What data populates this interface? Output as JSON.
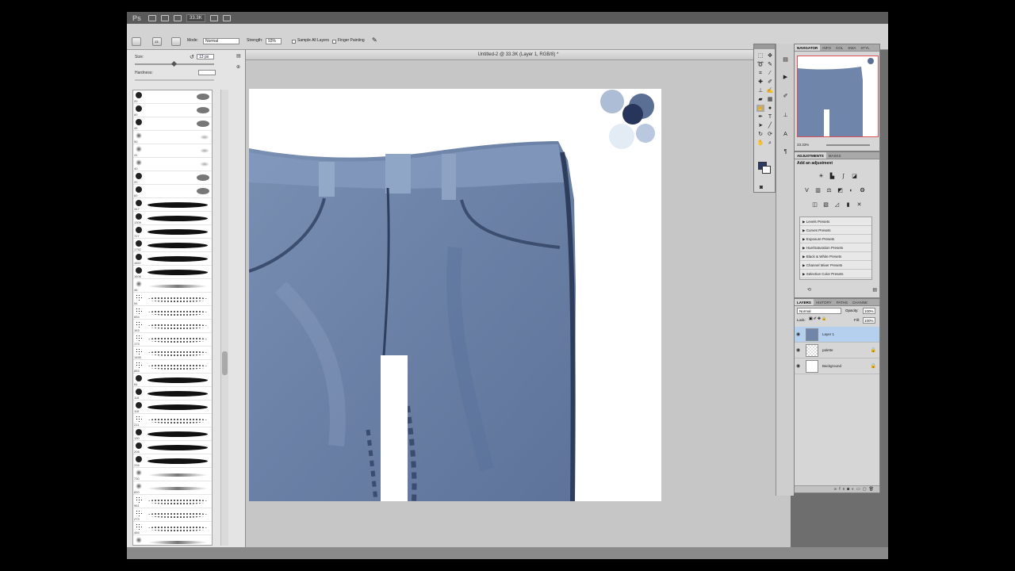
{
  "app": {
    "logo": "Ps",
    "zoom_display": "33.3K"
  },
  "options_bar": {
    "mode_label": "Mode:",
    "mode_value": "Normal",
    "strength_label": "Strength:",
    "strength_value": "93%",
    "sample_all_layers": "Sample All Layers",
    "finger_painting": "Finger Painting",
    "brush_size_display": "13"
  },
  "brush_panel": {
    "size_label": "Size:",
    "size_value": "13 px",
    "hardness_label": "Hardness:",
    "brushes": [
      {
        "size": "20",
        "kind": "round"
      },
      {
        "size": "60",
        "kind": "round"
      },
      {
        "size": "45",
        "kind": "round"
      },
      {
        "size": "50",
        "kind": "soft"
      },
      {
        "size": "41",
        "kind": "soft"
      },
      {
        "size": "40",
        "kind": "soft"
      },
      {
        "size": "20",
        "kind": "round"
      },
      {
        "size": "60",
        "kind": "round"
      },
      {
        "size": "347",
        "kind": "stroke"
      },
      {
        "size": "1309",
        "kind": "stroke"
      },
      {
        "size": "727",
        "kind": "stroke"
      },
      {
        "size": "1752",
        "kind": "stroke"
      },
      {
        "size": "1857",
        "kind": "stroke"
      },
      {
        "size": "1606",
        "kind": "stroke"
      },
      {
        "size": "46",
        "kind": "soft-stroke"
      },
      {
        "size": "54",
        "kind": "spatter"
      },
      {
        "size": "654",
        "kind": "spatter"
      },
      {
        "size": "163",
        "kind": "spatter"
      },
      {
        "size": "173",
        "kind": "spatter"
      },
      {
        "size": "1455",
        "kind": "spatter"
      },
      {
        "size": "883",
        "kind": "spatter"
      },
      {
        "size": "84",
        "kind": "stroke"
      },
      {
        "size": "118",
        "kind": "stroke"
      },
      {
        "size": "116",
        "kind": "stroke"
      },
      {
        "size": "211",
        "kind": "spatter"
      },
      {
        "size": "130",
        "kind": "stroke"
      },
      {
        "size": "208",
        "kind": "stroke"
      },
      {
        "size": "226",
        "kind": "stroke"
      },
      {
        "size": "730",
        "kind": "soft-stroke"
      },
      {
        "size": "820",
        "kind": "soft-stroke"
      },
      {
        "size": "961",
        "kind": "spatter"
      },
      {
        "size": "273",
        "kind": "spatter"
      },
      {
        "size": "465",
        "kind": "spatter"
      },
      {
        "size": "368",
        "kind": "soft-stroke"
      },
      {
        "size": "355",
        "kind": "soft-stroke"
      },
      {
        "size": "360",
        "kind": "soft-stroke"
      }
    ]
  },
  "document": {
    "title": "Untitled-2 @ 33.3K (Layer 1, RGB/8) *"
  },
  "navigator_panel": {
    "tabs": [
      "NAVIGATOR",
      "INFO",
      "COL",
      "SWA",
      "STYL"
    ],
    "zoom_value": "33.33%"
  },
  "adjustments_panel": {
    "tabs": [
      "ADJUSTMENTS",
      "MASKS"
    ],
    "heading": "Add an adjustment",
    "presets": [
      "Levels Presets",
      "Curves Presets",
      "Exposure Presets",
      "Hue/Saturation Presets",
      "Black & White Presets",
      "Channel Mixer Presets",
      "Selective Color Presets"
    ]
  },
  "layers_panel": {
    "tabs": [
      "LAYERS",
      "HISTORY",
      "PATHS",
      "CHANNE"
    ],
    "blend_mode": "Normal",
    "opacity_label": "Opacity:",
    "opacity_value": "100%",
    "lock_label": "Lock:",
    "fill_label": "Fill:",
    "fill_value": "100%",
    "layers": [
      {
        "name": "Layer 1",
        "selected": true,
        "locked": false
      },
      {
        "name": "palette",
        "selected": false,
        "locked": true
      },
      {
        "name": "Background",
        "selected": false,
        "locked": true
      }
    ]
  },
  "colors": {
    "foreground": "#2b3a66",
    "background": "#ffffff",
    "denim": "#6f85a9",
    "denim_dark": "#465b80",
    "selection": "#b5cfee"
  }
}
